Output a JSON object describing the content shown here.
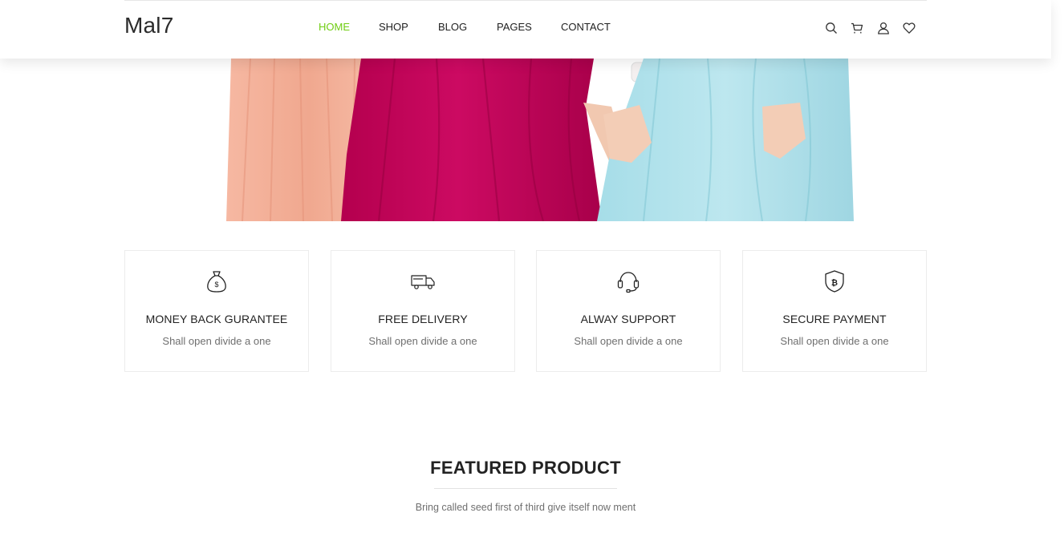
{
  "brand": {
    "logo_text": "Mal7",
    "accent_color": "#71cd14"
  },
  "nav": {
    "items": [
      {
        "label": "HOME",
        "active": true
      },
      {
        "label": "SHOP",
        "active": false
      },
      {
        "label": "BLOG",
        "active": false
      },
      {
        "label": "PAGES",
        "active": false
      },
      {
        "label": "CONTACT",
        "active": false
      }
    ]
  },
  "header_icons": [
    "search-icon",
    "cart-icon",
    "user-icon",
    "heart-icon"
  ],
  "hero": {
    "image": "three-women-in-long-dresses",
    "dress_colors": [
      "#f4b09a",
      "#c5005a",
      "#b5e2ea"
    ]
  },
  "features": [
    {
      "icon": "money-bag-icon",
      "title": "MONEY BACK GURANTEE",
      "description": "Shall open divide a one"
    },
    {
      "icon": "delivery-truck-icon",
      "title": "FREE DELIVERY",
      "description": "Shall open divide a one"
    },
    {
      "icon": "headset-icon",
      "title": "ALWAY SUPPORT",
      "description": "Shall open divide a one"
    },
    {
      "icon": "shield-bitcoin-icon",
      "title": "SECURE PAYMENT",
      "description": "Shall open divide a one"
    }
  ],
  "featured_section": {
    "title": "FEATURED PRODUCT",
    "subtitle": "Bring called seed first of third give itself now ment"
  }
}
